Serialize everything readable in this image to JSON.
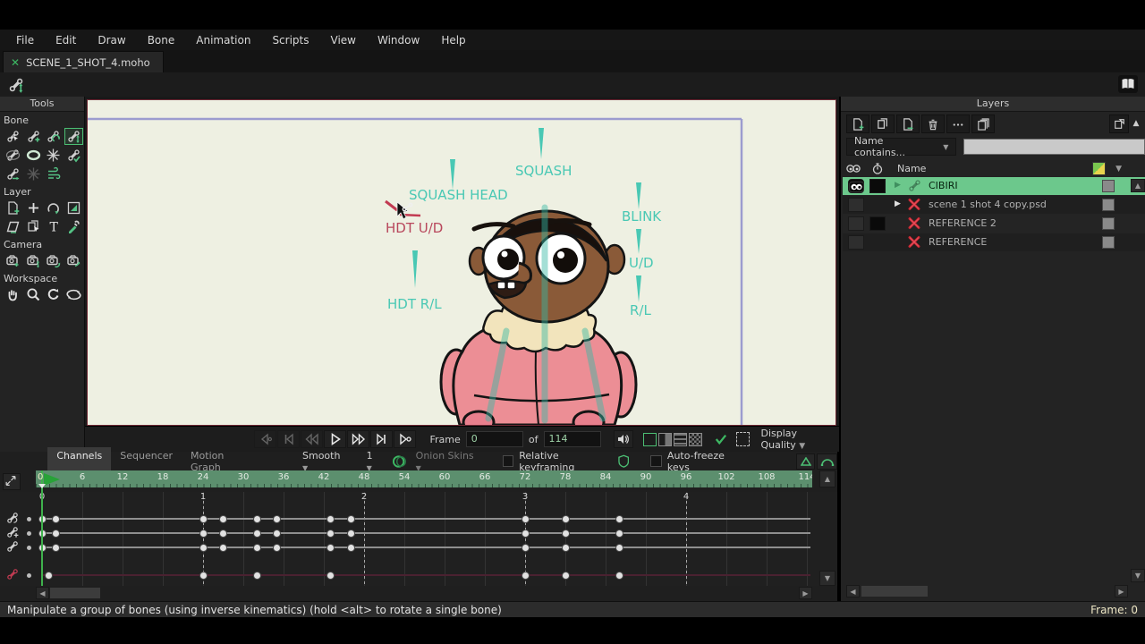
{
  "colors": {
    "accent_green": "#4cbf74",
    "selected_layer_green": "#6cc88c",
    "bone_teal": "#49c8b4",
    "selected_bone_red": "#c23b52",
    "ruler_green": "#5c8f6e"
  },
  "menu": {
    "items": [
      "File",
      "Edit",
      "Draw",
      "Bone",
      "Animation",
      "Scripts",
      "View",
      "Window",
      "Help"
    ]
  },
  "tab": {
    "title": "SCENE_1_SHOT_4.moho"
  },
  "toolbox": {
    "title": "Tools",
    "sections": [
      {
        "label": "Bone",
        "rows": [
          [
            {
              "id": "select-bone"
            },
            {
              "id": "add-bone"
            },
            {
              "id": "reparent-bone"
            },
            {
              "id": "transform-bone",
              "state": "selected"
            }
          ],
          [
            {
              "id": "bone-strength"
            },
            {
              "id": "manipulate-bones",
              "state": "active"
            },
            {
              "id": "bind-points"
            },
            {
              "id": "bind-layer"
            }
          ],
          [
            {
              "id": "offset-bone"
            },
            {
              "id": "bone-dynamics",
              "state": "disabled"
            },
            {
              "id": "wind"
            }
          ]
        ]
      },
      {
        "label": "Layer",
        "rows": [
          [
            {
              "id": "transform-layer"
            },
            {
              "id": "add-point"
            },
            {
              "id": "rotate-layer"
            },
            {
              "id": "flip-layer"
            }
          ],
          [
            {
              "id": "shear-layer"
            },
            {
              "id": "select-layer"
            },
            {
              "id": "text-tool"
            },
            {
              "id": "eyedropper"
            }
          ]
        ]
      },
      {
        "label": "Camera",
        "rows": [
          [
            {
              "id": "track-camera"
            },
            {
              "id": "zoom-camera"
            },
            {
              "id": "roll-camera"
            },
            {
              "id": "pan-camera"
            }
          ]
        ]
      },
      {
        "label": "Workspace",
        "rows": [
          [
            {
              "id": "pan-workspace"
            },
            {
              "id": "zoom-workspace"
            },
            {
              "id": "rotate-workspace"
            },
            {
              "id": "orbit-workspace"
            }
          ]
        ]
      }
    ]
  },
  "canvas": {
    "labels": [
      {
        "id": "squash",
        "text": "SQUASH"
      },
      {
        "id": "squash-head",
        "text": "SQUASH HEAD"
      },
      {
        "id": "hdt-ud",
        "text": "HDT U/D",
        "selected": true
      },
      {
        "id": "hdt-rl",
        "text": "HDT R/L"
      },
      {
        "id": "blink",
        "text": "BLINK"
      },
      {
        "id": "ud",
        "text": "U/D"
      },
      {
        "id": "rl",
        "text": "R/L"
      }
    ]
  },
  "playback": {
    "buttons": [
      {
        "id": "prev-keyframe",
        "enabled": false
      },
      {
        "id": "first-frame",
        "enabled": false
      },
      {
        "id": "step-back",
        "enabled": false
      },
      {
        "id": "play",
        "enabled": true
      },
      {
        "id": "step-forward",
        "enabled": true
      },
      {
        "id": "last-frame",
        "enabled": true
      },
      {
        "id": "next-keyframe",
        "enabled": true
      }
    ],
    "frame_label": "Frame",
    "frame_value": "0",
    "of_label": "of",
    "total_frames": "114",
    "display_quality_label": "Display Quality"
  },
  "timeline": {
    "tabs": [
      {
        "label": "Channels",
        "active": true
      },
      {
        "label": "Sequencer",
        "active": false
      },
      {
        "label": "Motion Graph",
        "active": false
      }
    ],
    "smoothing_label": "Smooth",
    "step_value": "1",
    "onion_label": "Onion Skins",
    "relative_label": "Relative keyframing",
    "autofreeze_label": "Auto-freeze keys",
    "ruler": {
      "start": 0,
      "end": 114,
      "label_step": 6,
      "current_frame": 0
    },
    "seconds_labels": [
      "0",
      "1",
      "2",
      "3",
      "4"
    ],
    "channels": [
      {
        "id": "bone-rotation",
        "keys": [
          0,
          2,
          24,
          27,
          32,
          35,
          43,
          46,
          72,
          78,
          86
        ],
        "style": "white"
      },
      {
        "id": "bone-translation",
        "keys": [
          0,
          2,
          24,
          27,
          32,
          35,
          43,
          46,
          72,
          78,
          86
        ],
        "style": "white"
      },
      {
        "id": "bone-scale",
        "keys": [
          0,
          2,
          24,
          27,
          32,
          35,
          43,
          46,
          72,
          78,
          86
        ],
        "style": "white"
      },
      {
        "id": "bone-selection",
        "keys": [
          1,
          24,
          32,
          43,
          72,
          78,
          86
        ],
        "style": "red"
      }
    ]
  },
  "layers": {
    "title": "Layers",
    "toolbar": [
      {
        "id": "new-layer"
      },
      {
        "id": "duplicate-layer"
      },
      {
        "id": "export-layer"
      },
      {
        "id": "delete-layer"
      },
      {
        "id": "more-options"
      },
      {
        "id": "layer-stack"
      }
    ],
    "filter_label": "Name contains...",
    "filter_value": "",
    "name_header": "Name",
    "rows": [
      {
        "name": "CIBIRI",
        "selected": true,
        "visible": true,
        "timer": true,
        "expander": true,
        "type": "bone"
      },
      {
        "name": "scene 1 shot 4 copy.psd",
        "selected": false,
        "visible": false,
        "timer": false,
        "expander": true,
        "type": "missing"
      },
      {
        "name": "REFERENCE 2",
        "selected": false,
        "visible": false,
        "timer": true,
        "expander": false,
        "type": "missing"
      },
      {
        "name": "REFERENCE",
        "selected": false,
        "visible": false,
        "timer": false,
        "expander": false,
        "type": "missing"
      }
    ]
  },
  "status": {
    "message": "Manipulate a group of bones (using inverse kinematics) (hold <alt> to rotate a single bone)",
    "frame_indicator": "Frame: 0"
  }
}
